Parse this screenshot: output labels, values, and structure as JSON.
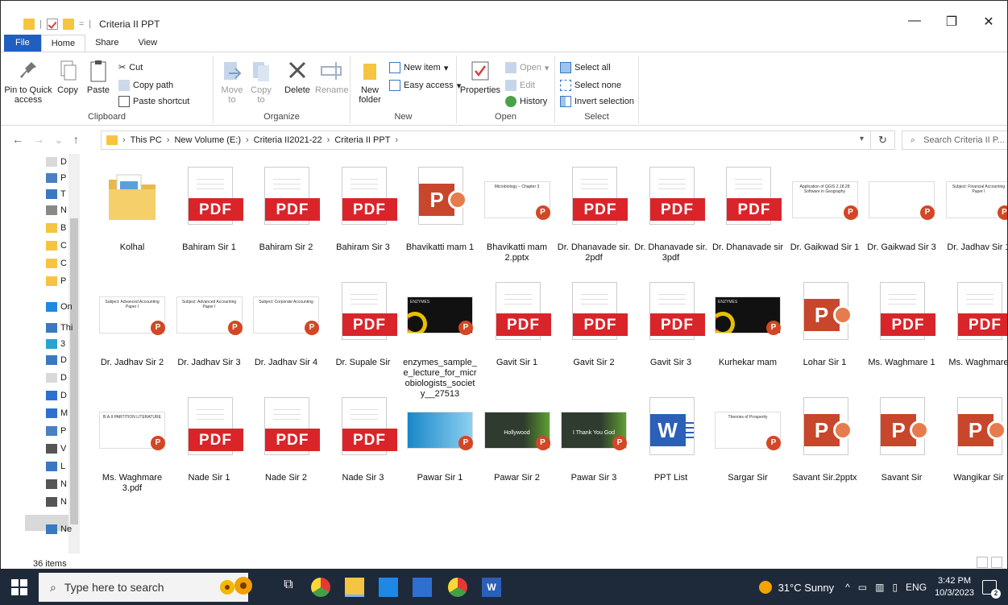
{
  "window": {
    "title": "Criteria II PPT",
    "controls": {
      "minimize": "—",
      "maximize": "❐",
      "close": "✕"
    }
  },
  "ribbon": {
    "tabs": [
      "File",
      "Home",
      "Share",
      "View"
    ],
    "clipboard": {
      "label": "Clipboard",
      "pin": "Pin to Quick access",
      "copy": "Copy",
      "paste": "Paste",
      "cut": "Cut",
      "copy_path": "Copy path",
      "paste_shortcut": "Paste shortcut"
    },
    "organize": {
      "label": "Organize",
      "move_to": "Move to",
      "copy_to": "Copy to",
      "delete": "Delete",
      "rename": "Rename"
    },
    "new": {
      "label": "New",
      "new_folder": "New folder",
      "new_item": "New item",
      "easy_access": "Easy access"
    },
    "open": {
      "label": "Open",
      "properties": "Properties",
      "open": "Open",
      "edit": "Edit",
      "history": "History"
    },
    "select": {
      "label": "Select",
      "select_all": "Select all",
      "select_none": "Select none",
      "invert": "Invert selection"
    }
  },
  "address": {
    "crumbs": [
      "This PC",
      "New Volume (E:)",
      "Criteria II2021-22",
      "Criteria II PPT"
    ],
    "search_placeholder": "Search Criteria II P..."
  },
  "navpane": {
    "items": [
      "D",
      "P",
      "T",
      "N",
      "B",
      "C",
      "C",
      "P",
      "On",
      "Thi",
      "3",
      "D",
      "D",
      "D",
      "M",
      "P",
      "V",
      "L",
      "N",
      "N",
      "Ne"
    ]
  },
  "files": [
    {
      "name": "Kolhal",
      "kind": "folder"
    },
    {
      "name": "Bahiram Sir 1",
      "kind": "pdf"
    },
    {
      "name": "Bahiram Sir 2",
      "kind": "pdf"
    },
    {
      "name": "Bahiram Sir 3",
      "kind": "pdf"
    },
    {
      "name": "Bhavikatti mam 1",
      "kind": "ppt"
    },
    {
      "name": "Bhavikatti mam 2.pptx",
      "kind": "slide",
      "slide_text": "Microbiology – Chapter 3"
    },
    {
      "name": "Dr. Dhanavade sir. 2pdf",
      "kind": "pdf"
    },
    {
      "name": "Dr. Dhanavade sir. 3pdf",
      "kind": "pdf"
    },
    {
      "name": "Dr. Dhanavade sir",
      "kind": "pdf"
    },
    {
      "name": "Dr. Gaikwad Sir 1",
      "kind": "slide",
      "slide_text": "Application of QGIS 2.18.28 Software in Geography"
    },
    {
      "name": "Dr. Gaikwad Sir 3",
      "kind": "slide",
      "slide_text": ""
    },
    {
      "name": "Dr. Jadhav Sir 1",
      "kind": "slide",
      "slide_text": "Subject: Financial Accounting Paper I"
    },
    {
      "name": "Dr. Jadhav Sir 2",
      "kind": "slide",
      "slide_text": "Subject: Advanced Accounting Paper I"
    },
    {
      "name": "Dr. Jadhav Sir 3",
      "kind": "slide",
      "slide_text": "Subject: Advanced Accounting Paper I"
    },
    {
      "name": "Dr. Jadhav Sir 4",
      "kind": "slide",
      "slide_text": "Subject: Corporate Accounting"
    },
    {
      "name": "Dr. Supale Sir",
      "kind": "pdf"
    },
    {
      "name": "enzymes_sample_e_lecture_for_microbiologists_society__27513",
      "kind": "dark",
      "slide_text": "ENZYMES"
    },
    {
      "name": "Gavit Sir 1",
      "kind": "pdf"
    },
    {
      "name": "Gavit Sir 2",
      "kind": "pdf"
    },
    {
      "name": "Gavit Sir 3",
      "kind": "pdf"
    },
    {
      "name": "Kurhekar mam",
      "kind": "dark",
      "slide_text": "ENZYMES"
    },
    {
      "name": "Lohar Sir 1",
      "kind": "ppt"
    },
    {
      "name": "Ms. Waghmare 1",
      "kind": "pdf"
    },
    {
      "name": "Ms. Waghmare",
      "kind": "pdf"
    },
    {
      "name": "Ms. Waghmare 3.pdf",
      "kind": "slide",
      "slide_text": "B.A.II PARTITION LITERATURE"
    },
    {
      "name": "Nade Sir 1",
      "kind": "pdf"
    },
    {
      "name": "Nade Sir 2",
      "kind": "pdf"
    },
    {
      "name": "Nade Sir 3",
      "kind": "pdf"
    },
    {
      "name": "Pawar Sir 1",
      "kind": "blue",
      "slide_text": ""
    },
    {
      "name": "Pawar Sir 2",
      "kind": "green",
      "slide_text": "Hollywood"
    },
    {
      "name": "Pawar Sir 3",
      "kind": "green",
      "slide_text": "I Thank You God"
    },
    {
      "name": "PPT List",
      "kind": "word"
    },
    {
      "name": "Sargar Sir",
      "kind": "slide",
      "slide_text": "Theories of Prosperity"
    },
    {
      "name": "Savant Sir.2pptx",
      "kind": "ppt"
    },
    {
      "name": "Savant Sir",
      "kind": "ppt"
    },
    {
      "name": "Wangikar Sir",
      "kind": "ppt"
    }
  ],
  "status": {
    "count": "36 items"
  },
  "taskbar": {
    "search_placeholder": "Type here to search",
    "weather": "31°C  Sunny",
    "lang": "ENG",
    "time": "3:42 PM",
    "date": "10/3/2023",
    "notif_count": "2"
  }
}
